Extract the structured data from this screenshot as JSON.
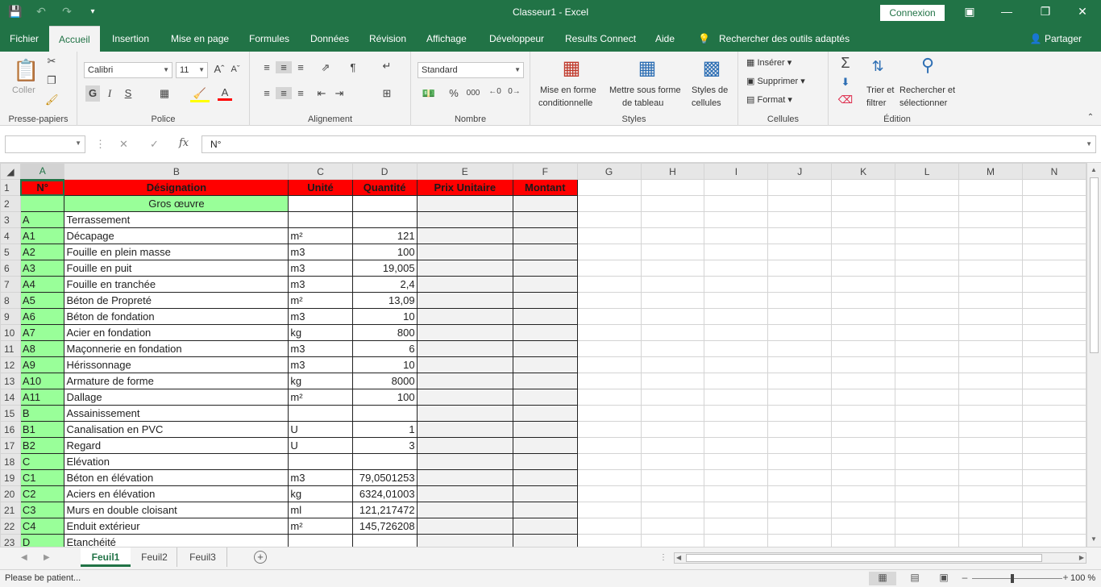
{
  "window": {
    "title": "Classeur1  -  Excel",
    "connexion_label": "Connexion",
    "share_label": "Partager"
  },
  "tabs": [
    "Fichier",
    "Accueil",
    "Insertion",
    "Mise en page",
    "Formules",
    "Données",
    "Révision",
    "Affichage",
    "Développeur",
    "Results Connect",
    "Aide",
    "Rechercher des outils adaptés"
  ],
  "ribbon": {
    "clipboard": {
      "label": "Presse-papiers",
      "paste": "Coller"
    },
    "font": {
      "label": "Police",
      "name": "Calibri",
      "size": "11",
      "bold": "G",
      "italic": "I",
      "underline": "S"
    },
    "alignment": {
      "label": "Alignement"
    },
    "number": {
      "label": "Nombre",
      "format": "Standard",
      "percent": "%",
      "thousands": "000"
    },
    "styles": {
      "label": "Styles",
      "cond_l1": "Mise en forme",
      "cond_l2": "conditionnelle",
      "table_l1": "Mettre sous forme",
      "table_l2": "de tableau",
      "cell_l1": "Styles de",
      "cell_l2": "cellules"
    },
    "cells": {
      "label": "Cellules",
      "insert": "Insérer",
      "delete": "Supprimer",
      "format": "Format"
    },
    "editing": {
      "label": "Édition",
      "sort_l1": "Trier et",
      "sort_l2": "filtrer",
      "find_l1": "Rechercher et",
      "find_l2": "sélectionner"
    }
  },
  "formula_bar": {
    "name_box": "",
    "formula": "N°"
  },
  "sheet": {
    "columns": [
      "A",
      "B",
      "C",
      "D",
      "E",
      "F",
      "G",
      "H",
      "I",
      "J",
      "K",
      "L",
      "M",
      "N"
    ],
    "header_row": [
      "N°",
      "Désignation",
      "Unité",
      "Quantité",
      "Prix Unitaire",
      "Montant"
    ],
    "rows": [
      {
        "n": "2",
        "a": "",
        "b": "Gros œuvre",
        "c": "",
        "d": ""
      },
      {
        "n": "3",
        "a": "A",
        "b": "Terrassement",
        "c": "",
        "d": ""
      },
      {
        "n": "4",
        "a": "A1",
        "b": "Décapage",
        "c": "m²",
        "d": "121"
      },
      {
        "n": "5",
        "a": "A2",
        "b": "Fouille en plein masse",
        "c": "m3",
        "d": "100"
      },
      {
        "n": "6",
        "a": "A3",
        "b": "Fouille en puit",
        "c": "m3",
        "d": "19,005"
      },
      {
        "n": "7",
        "a": "A4",
        "b": "Fouille en tranchée",
        "c": "m3",
        "d": "2,4"
      },
      {
        "n": "8",
        "a": "A5",
        "b": "Béton de Propreté",
        "c": "m²",
        "d": "13,09"
      },
      {
        "n": "9",
        "a": "A6",
        "b": "Béton de fondation",
        "c": "m3",
        "d": "10"
      },
      {
        "n": "10",
        "a": "A7",
        "b": "Acier en fondation",
        "c": "kg",
        "d": "800"
      },
      {
        "n": "11",
        "a": "A8",
        "b": "Maçonnerie en fondation",
        "c": "m3",
        "d": "6"
      },
      {
        "n": "12",
        "a": "A9",
        "b": "Hérissonnage",
        "c": "m3",
        "d": "10"
      },
      {
        "n": "13",
        "a": "A10",
        "b": "Armature de forme",
        "c": "kg",
        "d": "8000"
      },
      {
        "n": "14",
        "a": "A11",
        "b": "Dallage",
        "c": "m²",
        "d": "100"
      },
      {
        "n": "15",
        "a": "B",
        "b": "Assainissement",
        "c": "",
        "d": ""
      },
      {
        "n": "16",
        "a": "B1",
        "b": "Canalisation en PVC",
        "c": "U",
        "d": "1"
      },
      {
        "n": "17",
        "a": "B2",
        "b": "Regard",
        "c": "U",
        "d": "3"
      },
      {
        "n": "18",
        "a": "C",
        "b": "Elévation",
        "c": "",
        "d": ""
      },
      {
        "n": "19",
        "a": "C1",
        "b": "Béton en élévation",
        "c": "m3",
        "d": "79,0501253"
      },
      {
        "n": "20",
        "a": "C2",
        "b": "Aciers en élévation",
        "c": "kg",
        "d": "6324,01003"
      },
      {
        "n": "21",
        "a": "C3",
        "b": "Murs en double cloisant",
        "c": "ml",
        "d": "121,217472"
      },
      {
        "n": "22",
        "a": "C4",
        "b": "Enduit extérieur",
        "c": "m²",
        "d": "145,726208"
      },
      {
        "n": "23",
        "a": "D",
        "b": "Etanchéité",
        "c": "",
        "d": ""
      }
    ]
  },
  "sheet_tabs": [
    "Feuil1",
    "Feuil2",
    "Feuil3"
  ],
  "status": {
    "message": "Please be patient...",
    "zoom": "100 %"
  },
  "colors": {
    "accent": "#217346",
    "header_fill": "#ff0000",
    "green_fill": "#99ff99"
  }
}
